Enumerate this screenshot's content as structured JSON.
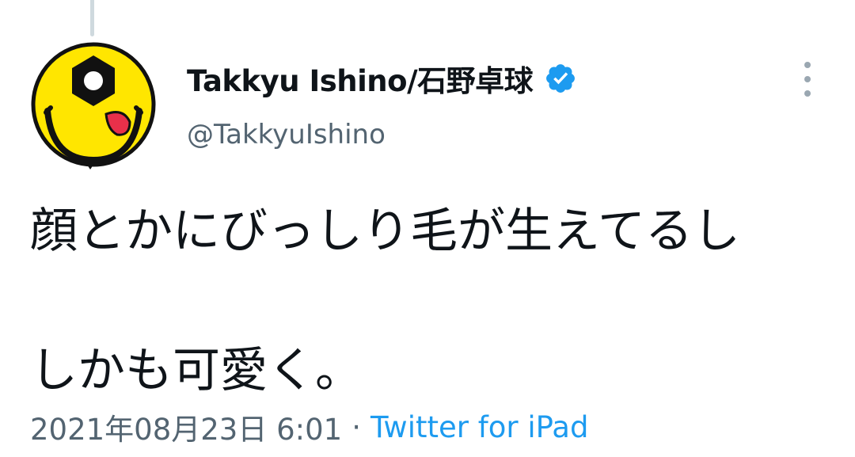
{
  "tweet": {
    "author": {
      "display_name": "Takkyu Ishino/石野卓球",
      "handle": "@TakkyuIshino",
      "verified": true
    },
    "text_lines": [
      "顔とかにびっしり毛が生えてるし",
      "",
      "しかも可愛く。"
    ],
    "timestamp": "2021年08月23日 6:01",
    "separator": "·",
    "source": "Twitter for iPad"
  },
  "icons": {
    "avatar": "yellow-smiley-hex-nut-eye-avatar",
    "verified": "verified-badge-icon",
    "more": "more-vertical-icon"
  },
  "colors": {
    "link": "#1d9bf0",
    "secondary_text": "#536471",
    "primary_text": "#0f1419",
    "avatar_yellow": "#ffe600"
  }
}
